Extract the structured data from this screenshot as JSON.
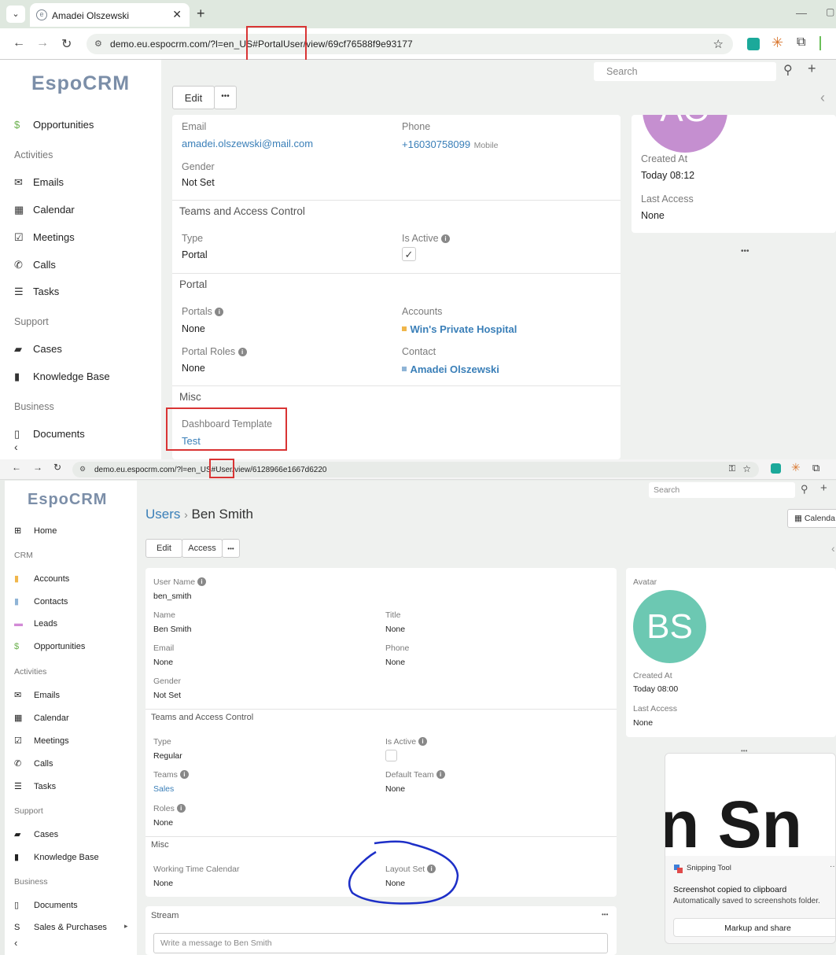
{
  "browser1": {
    "tab_title": "Amadei Olszewski",
    "url": "demo.eu.espocrm.com/?l=en_US#PortalUser/view/69cf76588f9e93177"
  },
  "app1": {
    "logo": "EspoCRM",
    "search_placeholder": "Search",
    "edit": "Edit",
    "more": "•••",
    "sidebar": {
      "opportunities": "Opportunities",
      "activities": "Activities",
      "emails": "Emails",
      "calendar": "Calendar",
      "meetings": "Meetings",
      "calls": "Calls",
      "tasks": "Tasks",
      "support": "Support",
      "cases": "Cases",
      "kb": "Knowledge Base",
      "business": "Business",
      "documents": "Documents"
    },
    "fields": {
      "email_label": "Email",
      "email_value": "amadei.olszewski@mail.com",
      "phone_label": "Phone",
      "phone_value": "+16030758099",
      "phone_type": "Mobile",
      "gender_label": "Gender",
      "gender_value": "Not Set",
      "teams_section": "Teams and Access Control",
      "type_label": "Type",
      "type_value": "Portal",
      "active_label": "Is Active",
      "portal_section": "Portal",
      "portals_label": "Portals",
      "portals_value": "None",
      "accounts_label": "Accounts",
      "accounts_value": "Win's Private Hospital",
      "roles_label": "Portal Roles",
      "roles_value": "None",
      "contact_label": "Contact",
      "contact_value": "Amadei Olszewski",
      "misc_section": "Misc",
      "dash_label": "Dashboard Template",
      "dash_value": "Test"
    },
    "right": {
      "avatar_initials": "AO",
      "created_label": "Created At",
      "created_value": "Today 08:12",
      "access_label": "Last Access",
      "access_value": "None",
      "more": "•••"
    }
  },
  "browser2": {
    "url": "demo.eu.espocrm.com/?l=en_US#User/view/6128966e1667d6220"
  },
  "app2": {
    "logo": "EspoCRM",
    "search_placeholder": "Search",
    "breadcrumb_root": "Users",
    "breadcrumb_sep": "›",
    "breadcrumb_current": "Ben Smith",
    "calendar_btn": "Calenda",
    "edit": "Edit",
    "access": "Access",
    "more": "•••",
    "sidebar": {
      "home": "Home",
      "crm": "CRM",
      "accounts": "Accounts",
      "contacts": "Contacts",
      "leads": "Leads",
      "opportunities": "Opportunities",
      "activities": "Activities",
      "emails": "Emails",
      "calendar": "Calendar",
      "meetings": "Meetings",
      "calls": "Calls",
      "tasks": "Tasks",
      "support": "Support",
      "cases": "Cases",
      "kb": "Knowledge Base",
      "business": "Business",
      "documents": "Documents",
      "sales": "Sales & Purchases"
    },
    "fields": {
      "username_label": "User Name",
      "username_value": "ben_smith",
      "name_label": "Name",
      "name_value": "Ben Smith",
      "title_label": "Title",
      "title_value": "None",
      "email_label": "Email",
      "email_value": "None",
      "phone_label": "Phone",
      "phone_value": "None",
      "gender_label": "Gender",
      "gender_value": "Not Set",
      "teams_section": "Teams and Access Control",
      "type_label": "Type",
      "type_value": "Regular",
      "active_label": "Is Active",
      "teams_label": "Teams",
      "teams_value": "Sales",
      "default_team_label": "Default Team",
      "default_team_value": "None",
      "roles_label": "Roles",
      "roles_value": "None",
      "misc_section": "Misc",
      "wtc_label": "Working Time Calendar",
      "wtc_value": "None",
      "layout_label": "Layout Set",
      "layout_value": "None"
    },
    "right": {
      "avatar_label": "Avatar",
      "avatar_initials": "BS",
      "created_label": "Created At",
      "created_value": "Today 08:00",
      "access_label": "Last Access",
      "access_value": "None",
      "more": "•••"
    },
    "stream": {
      "title": "Stream",
      "more": "•••",
      "placeholder": "Write a message to Ben Smith"
    }
  },
  "snip": {
    "preview_text": "n Sn",
    "title": "Snipping Tool",
    "message": "Screenshot copied to clipboard",
    "sub": "Automatically saved to screenshots folder.",
    "action": "Markup and share",
    "more": "···"
  }
}
